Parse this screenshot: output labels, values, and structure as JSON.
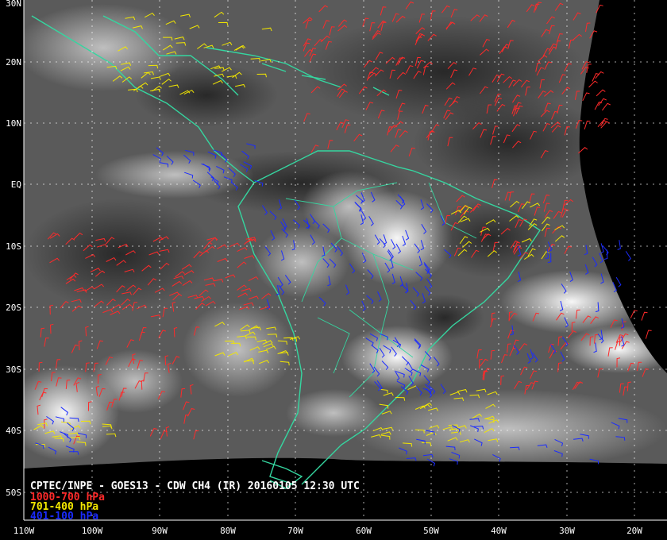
{
  "image": {
    "title": "CPTEC/INPE - GOES13 - CDW CH4 (IR) 20160105 12:30 UTC",
    "source_line": "CPTEC/INPE - GOES13 - CDW CH4 (IR) 20160105 12:30 UTC"
  },
  "legend": [
    {
      "label": "1000-700 hPa",
      "color": "#ff2a2a"
    },
    {
      "label": "701-400 hPa",
      "color": "#f2e600"
    },
    {
      "label": "401-100 hPa",
      "color": "#1a2bff"
    }
  ],
  "lat_labels": [
    "30N",
    "20N",
    "10N",
    "EQ",
    "10S",
    "20S",
    "30S",
    "40S",
    "50S"
  ],
  "lon_labels": [
    "110W",
    "100W",
    "90W",
    "80W",
    "70W",
    "60W",
    "50W",
    "40W",
    "30W",
    "20W"
  ],
  "colors": {
    "coastline": "#35d6a0",
    "grid": "#ffffff",
    "background": "#000000",
    "cloud_low": "#4a4a4a",
    "cloud_high": "#f2f2f2"
  }
}
